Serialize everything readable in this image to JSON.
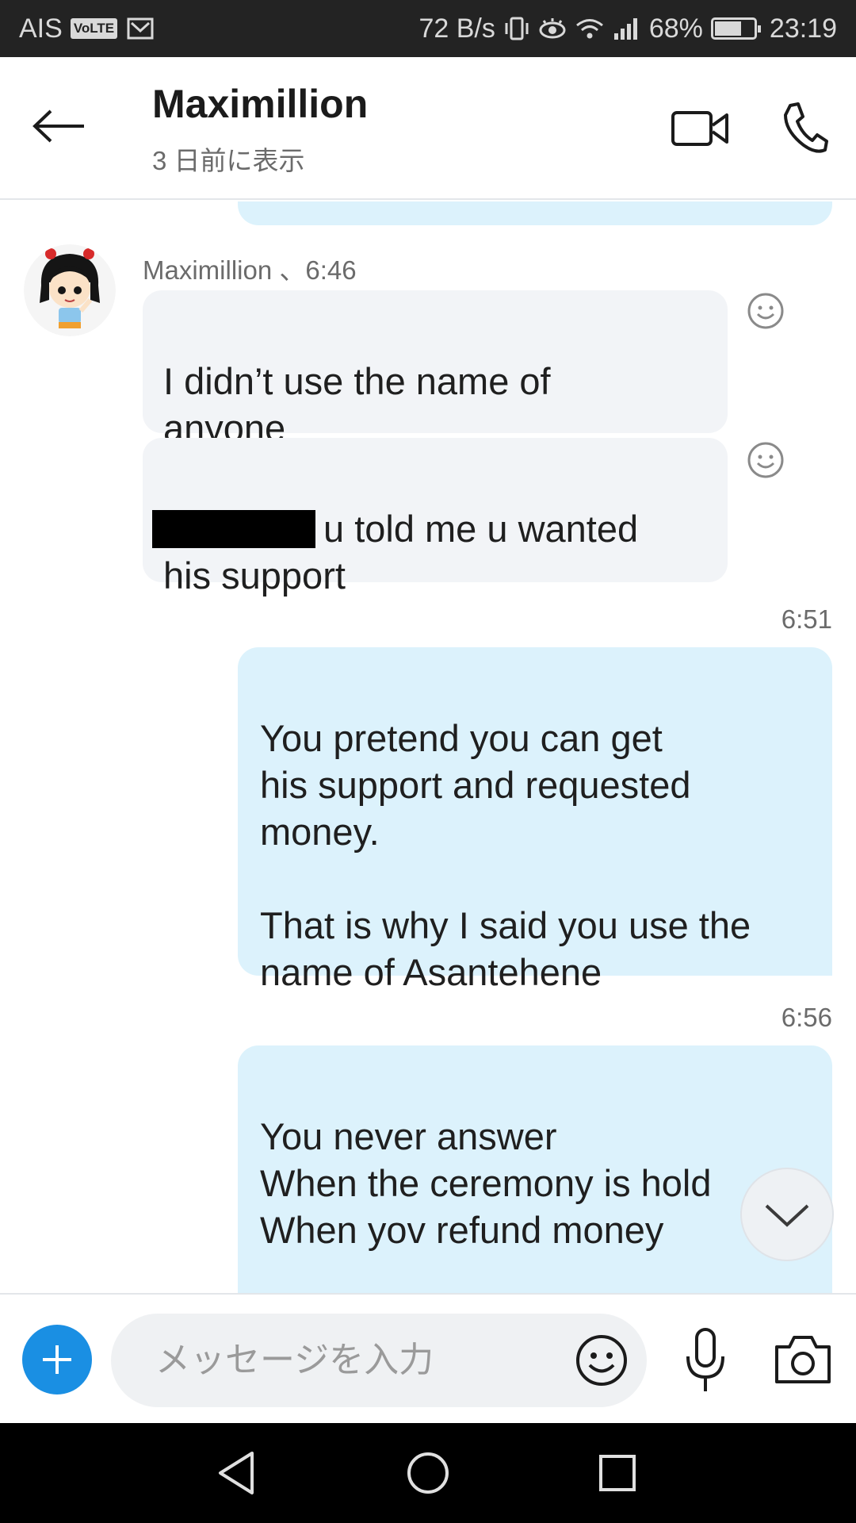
{
  "status_bar": {
    "carrier": "AIS",
    "volte": "VoLTE",
    "speed": "72 B/s",
    "battery": "68%",
    "battery_level": 0.68,
    "time": "23:19"
  },
  "header": {
    "contact_name": "Maximillion",
    "last_seen": "3 日前に表示"
  },
  "messages": {
    "sender_line": "Maximillion 、6:46",
    "incoming_1": "I didn’t use the name of\nanyone",
    "incoming_2_rest": "u told me u wanted",
    "incoming_2_line2": "his support",
    "time_1": "6:51",
    "outgoing_1": "You pretend you can get\nhis support and requested\nmoney.\n\nThat is why I said you use the\nname of Asantehene",
    "time_2": "6:56",
    "outgoing_2": "You never answer\nWhen the ceremony is hold\nWhen yov refund money\n\nThat is why i said you scam"
  },
  "composer": {
    "placeholder": "メッセージを入力"
  },
  "colors": {
    "accent": "#1a8fe3",
    "outgoing_bubble": "#dcf2fc",
    "incoming_bubble": "#f2f4f7"
  },
  "icons": {
    "back": "arrow-left-icon",
    "video": "video-camera-icon",
    "call": "phone-icon",
    "react": "smiley-icon",
    "scroll": "chevron-down-icon",
    "add": "plus-icon",
    "emoji": "emoji-icon",
    "mic": "microphone-icon",
    "camera": "camera-icon"
  }
}
